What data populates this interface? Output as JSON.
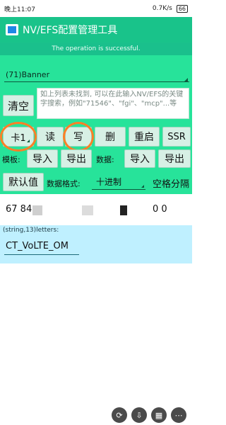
{
  "status_bar": {
    "time": "晚上11:07",
    "net_speed": "0.7K/s",
    "battery": "66"
  },
  "app": {
    "title": "NV/EFS配置管理工具"
  },
  "toast": {
    "message": "The operation is successful."
  },
  "item_select": {
    "value": "(71)Banner"
  },
  "search": {
    "clear_label": "清空",
    "placeholder": "如上列表未找到, 可以在此输入NV/EFS的关键字搜索，例如\"71546\"、\"fgi\"、\"mcp\"...等"
  },
  "actions": {
    "card_label": "卡1",
    "read_label": "读",
    "write_label": "写",
    "delete_label": "删",
    "restart_label": "重启",
    "ssr_label": "SSR"
  },
  "template_row": {
    "template_label": "模板:",
    "import_label": "导入",
    "export_label": "导出",
    "data_label": "数据:",
    "data_import_label": "导入",
    "data_export_label": "导出"
  },
  "format_row": {
    "default_label": "默认值",
    "format_label": "数据格式:",
    "format_value": "十进制",
    "separator_label": "空格分隔"
  },
  "data_values": {
    "prefix": "67 84",
    "suffix": "0 0"
  },
  "letters": {
    "label": "(string,13)letters:",
    "value": "CT_VoLTE_OM"
  },
  "colors": {
    "primary": "#19c38a",
    "panel": "#27e39a",
    "letters_bg": "#bff0ff",
    "annotation": "#ff7f27"
  }
}
